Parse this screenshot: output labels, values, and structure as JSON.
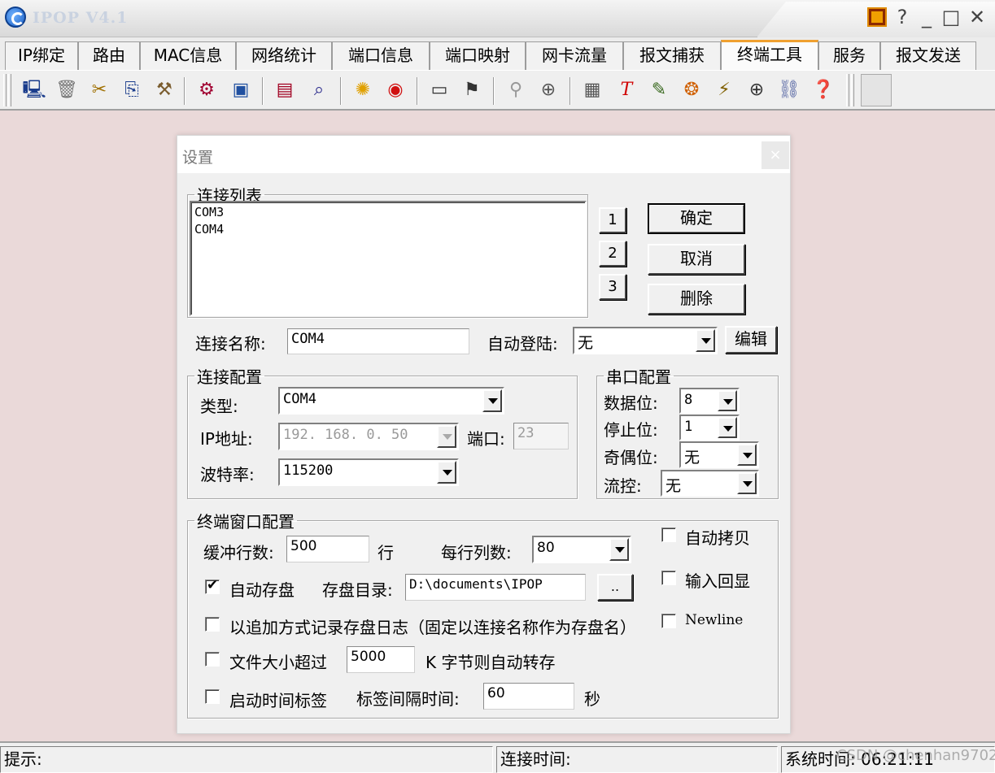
{
  "window": {
    "title": "IPOP V4.1",
    "controls": [
      "?",
      "_",
      "□",
      "✕"
    ]
  },
  "tabs": [
    {
      "label": "IP绑定"
    },
    {
      "label": "路由"
    },
    {
      "label": "MAC信息"
    },
    {
      "label": "网络统计"
    },
    {
      "label": "端口信息"
    },
    {
      "label": "端口映射"
    },
    {
      "label": "网卡流量"
    },
    {
      "label": "报文捕获"
    },
    {
      "label": "终端工具",
      "active": true
    },
    {
      "label": "服务"
    },
    {
      "label": "报文发送"
    }
  ],
  "toolbar": {
    "icons": [
      "new-session-icon",
      "trash-icon",
      "cut-icon",
      "copy-icon",
      "broom-icon",
      "find-icon",
      "screen-icon",
      "print-preview-icon",
      "search-docs-icon",
      "sun-icon",
      "record-icon",
      "terminal-icon",
      "wrench-icon",
      "zoom-icon",
      "target-icon",
      "calendar-icon",
      "text-tool-icon",
      "scissors-icon",
      "stamp-icon",
      "lightning-icon",
      "zoom-in-icon",
      "link-icon",
      "help-balloon-icon"
    ]
  },
  "dialog": {
    "title": "设置",
    "close": "×",
    "conn_list": {
      "legend": "连接列表",
      "items": [
        "COM3",
        "COM4"
      ]
    },
    "num_buttons": [
      "1",
      "2",
      "3"
    ],
    "ok": "确定",
    "cancel": "取消",
    "delete": "删除",
    "conn_name_label": "连接名称:",
    "conn_name_value": "COM4",
    "auto_login_label": "自动登陆:",
    "auto_login_value": "无",
    "edit": "编辑",
    "conn_config": {
      "legend": "连接配置",
      "type_label": "类型:",
      "type_value": "COM4",
      "ip_label": "IP地址:",
      "ip_value": "192. 168. 0. 50",
      "port_label": "端口:",
      "port_value": "23",
      "baud_label": "波特率:",
      "baud_value": "115200"
    },
    "serial_config": {
      "legend": "串口配置",
      "databits_label": "数据位:",
      "databits_value": "8",
      "stopbits_label": "停止位:",
      "stopbits_value": "1",
      "parity_label": "奇偶位:",
      "parity_value": "无",
      "flow_label": "流控:",
      "flow_value": "无"
    },
    "terminal_config": {
      "legend": "终端窗口配置",
      "buffer_label": "缓冲行数:",
      "buffer_value": "500",
      "buffer_unit": "行",
      "cols_label": "每行列数:",
      "cols_value": "80",
      "auto_copy": "自动拷贝",
      "echo": "输入回显",
      "newline": "Newline",
      "autosave_label": "自动存盘",
      "autosave_checked": true,
      "savedir_label": "存盘目录:",
      "savedir_value": "D:\\documents\\IPOP",
      "browse": "..",
      "append_log": "以追加方式记录存盘日志（固定以连接名称作为存盘名）",
      "filesize_label": "文件大小超过",
      "filesize_value": "5000",
      "filesize_unit": "K 字节则自动转存",
      "timestamp_label": "启动时间标签",
      "interval_label": "标签间隔时间:",
      "interval_value": "60",
      "interval_unit": "秒"
    }
  },
  "statusbar": {
    "hint": "提示:",
    "conn_time": "连接时间:",
    "sys_time": "系统时间: 06:21:11"
  },
  "watermark": "CSDN @chenhan9702"
}
